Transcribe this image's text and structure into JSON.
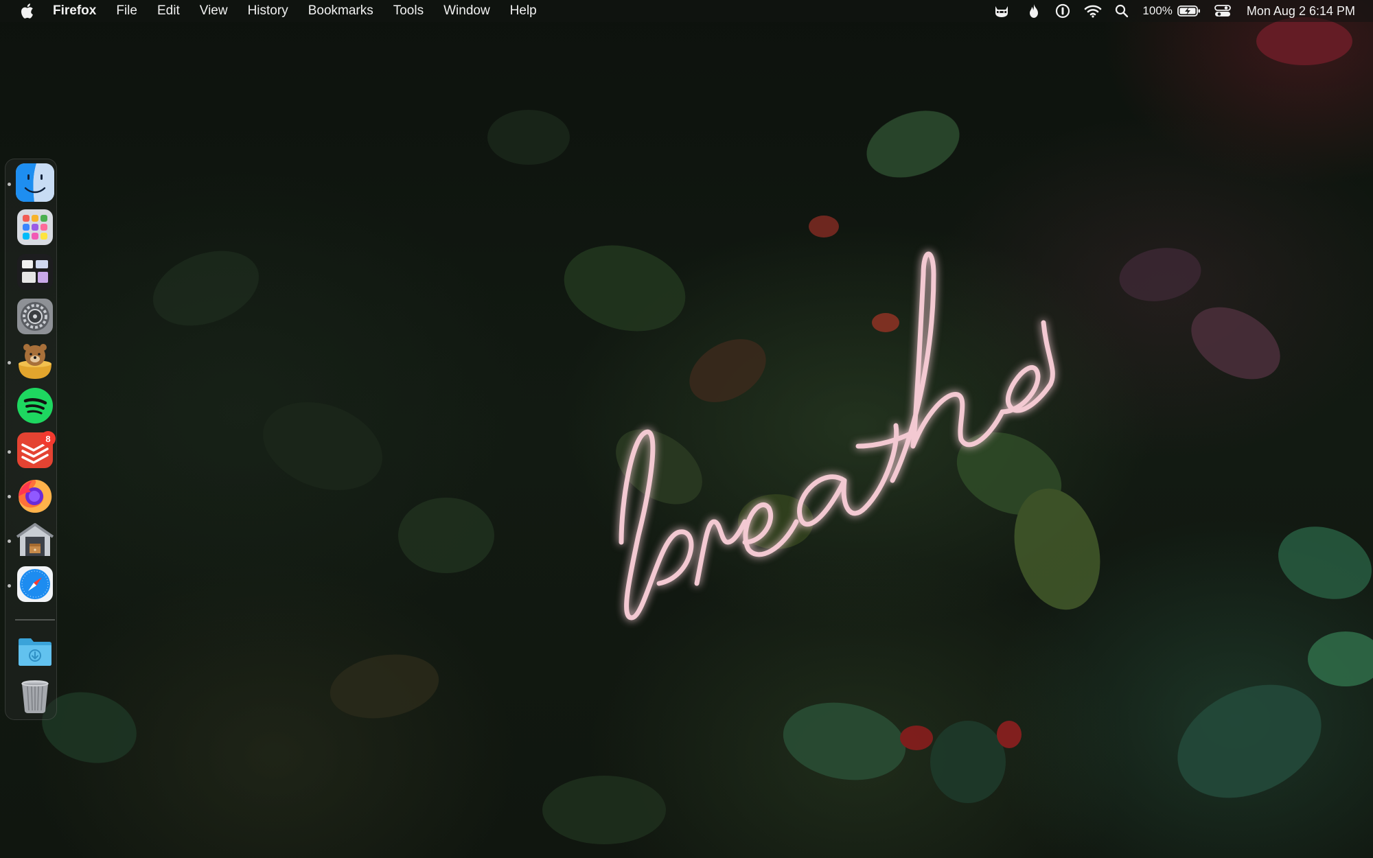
{
  "menubar": {
    "app_name": "Firefox",
    "menus": [
      "File",
      "Edit",
      "View",
      "History",
      "Bookmarks",
      "Tools",
      "Window",
      "Help"
    ],
    "status_icons": [
      "cat-icon",
      "flame-icon",
      "password-manager-icon",
      "wifi-icon",
      "search-icon",
      "battery-icon",
      "control-center-icon"
    ],
    "battery_percent": "100%",
    "clock": "Mon Aug 2  6:14 PM"
  },
  "wallpaper": {
    "neon_text": "breathe",
    "neon_color": "#f3c9d2"
  },
  "dock": {
    "apps": [
      {
        "name": "Finder",
        "icon": "finder-icon",
        "running": true
      },
      {
        "name": "Launchpad",
        "icon": "launchpad-icon",
        "running": false
      },
      {
        "name": "Mission Control",
        "icon": "mission-control-icon",
        "running": false
      },
      {
        "name": "System Preferences",
        "icon": "system-preferences-icon",
        "running": false
      },
      {
        "name": "Bear",
        "icon": "bear-icon",
        "running": true
      },
      {
        "name": "Spotify",
        "icon": "spotify-icon",
        "running": false
      },
      {
        "name": "Todoist",
        "icon": "todoist-icon",
        "running": true,
        "badge": "8"
      },
      {
        "name": "Firefox",
        "icon": "firefox-icon",
        "running": true
      },
      {
        "name": "Archive Utility",
        "icon": "archive-icon",
        "running": true
      },
      {
        "name": "Safari",
        "icon": "safari-icon",
        "running": true
      }
    ],
    "folders": [
      {
        "name": "Downloads",
        "icon": "downloads-folder-icon"
      },
      {
        "name": "Trash",
        "icon": "trash-icon"
      }
    ]
  },
  "colors": {
    "menubar_text": "#f2f2f2",
    "badge": "#f23a2f",
    "spotify": "#1ed760",
    "todoist": "#e44332",
    "foliage_dark": "#1c2a1c"
  }
}
